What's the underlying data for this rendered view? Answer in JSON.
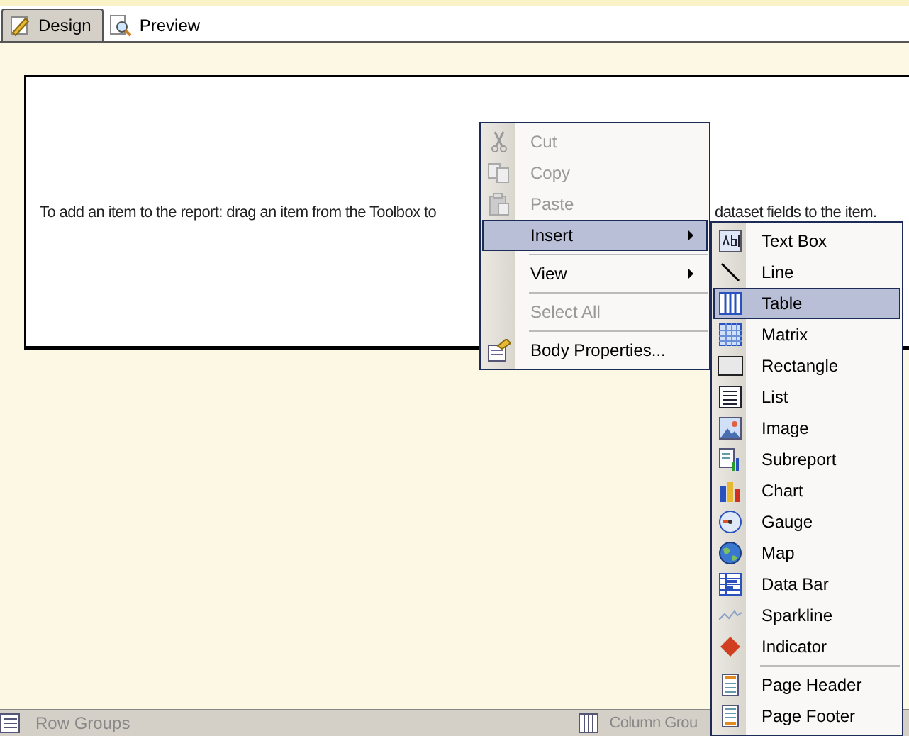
{
  "tabs": [
    {
      "label": "Design",
      "selected": true
    },
    {
      "label": "Preview",
      "selected": false
    }
  ],
  "report_body": {
    "hint_left": "To add an item to the report: drag an item from the Toolbox to",
    "hint_right": "dataset fields to the item."
  },
  "context_menu": {
    "items": [
      {
        "kind": "item",
        "label": "Cut",
        "disabled": true,
        "selected": false,
        "submenu": false
      },
      {
        "kind": "item",
        "label": "Copy",
        "disabled": true,
        "selected": false,
        "submenu": false
      },
      {
        "kind": "item",
        "label": "Paste",
        "disabled": true,
        "selected": false,
        "submenu": false
      },
      {
        "kind": "item",
        "label": "Insert",
        "disabled": false,
        "selected": true,
        "submenu": true
      },
      {
        "kind": "separator"
      },
      {
        "kind": "item",
        "label": "View",
        "disabled": false,
        "selected": false,
        "submenu": true
      },
      {
        "kind": "separator"
      },
      {
        "kind": "item",
        "label": "Select All",
        "disabled": true,
        "selected": false,
        "submenu": false
      },
      {
        "kind": "separator"
      },
      {
        "kind": "item",
        "label": "Body Properties...",
        "disabled": false,
        "selected": false,
        "submenu": false
      }
    ]
  },
  "insert_submenu": {
    "items": [
      {
        "kind": "item",
        "label": "Text Box",
        "selected": false
      },
      {
        "kind": "item",
        "label": "Line",
        "selected": false
      },
      {
        "kind": "item",
        "label": "Table",
        "selected": true
      },
      {
        "kind": "item",
        "label": "Matrix",
        "selected": false
      },
      {
        "kind": "item",
        "label": "Rectangle",
        "selected": false
      },
      {
        "kind": "item",
        "label": "List",
        "selected": false
      },
      {
        "kind": "item",
        "label": "Image",
        "selected": false
      },
      {
        "kind": "item",
        "label": "Subreport",
        "selected": false
      },
      {
        "kind": "item",
        "label": "Chart",
        "selected": false
      },
      {
        "kind": "item",
        "label": "Gauge",
        "selected": false
      },
      {
        "kind": "item",
        "label": "Map",
        "selected": false
      },
      {
        "kind": "item",
        "label": "Data Bar",
        "selected": false
      },
      {
        "kind": "item",
        "label": "Sparkline",
        "selected": false
      },
      {
        "kind": "item",
        "label": "Indicator",
        "selected": false
      },
      {
        "kind": "separator"
      },
      {
        "kind": "item",
        "label": "Page Header",
        "selected": false
      },
      {
        "kind": "item",
        "label": "Page Footer",
        "selected": false
      }
    ]
  },
  "grouping_pane": {
    "row_groups": "Row Groups",
    "column_groups": "Column Grou"
  }
}
